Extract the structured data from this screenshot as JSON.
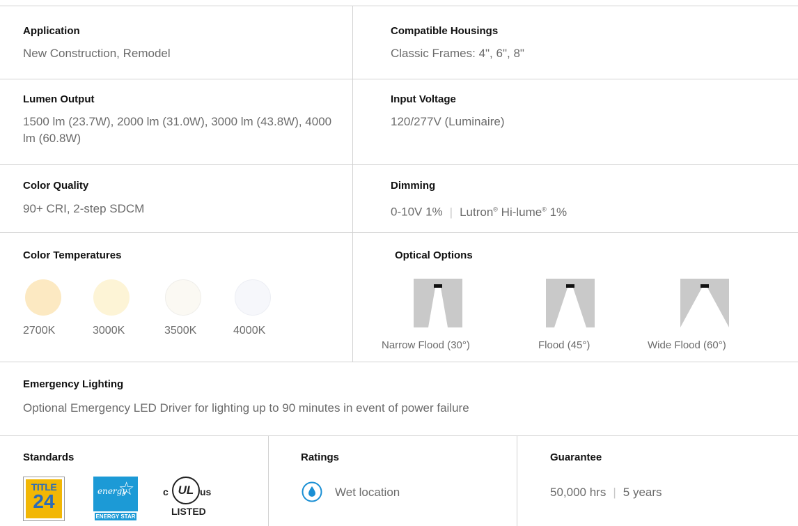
{
  "specs": {
    "application": {
      "label": "Application",
      "value": "New Construction, Remodel"
    },
    "housings": {
      "label": "Compatible Housings",
      "value": "Classic Frames: 4\", 6\", 8\""
    },
    "lumen": {
      "label": "Lumen Output",
      "value": "1500 lm (23.7W), 2000 lm (31.0W), 3000 lm (43.8W), 4000 lm (60.8W)"
    },
    "voltage": {
      "label": "Input Voltage",
      "value": "120/277V (Luminaire)"
    },
    "color_quality": {
      "label": "Color Quality",
      "value": "90+ CRI, 2-step SDCM"
    },
    "dimming": {
      "label": "Dimming",
      "value_a": "0-10V 1%",
      "separator": "|",
      "value_b_prefix": "Lutron",
      "value_b_reg1": "®",
      "value_b_mid": " Hi-lume",
      "value_b_reg2": "®",
      "value_b_suffix": " 1%"
    }
  },
  "color_temps": {
    "label": "Color Temperatures",
    "items": [
      {
        "label": "2700K",
        "color": "#fce9c2"
      },
      {
        "label": "3000K",
        "color": "#fdf4d6"
      },
      {
        "label": "3500K",
        "color": "#fcfaf4"
      },
      {
        "label": "4000K",
        "color": "#f6f7fb"
      }
    ]
  },
  "optics": {
    "label": "Optical Options",
    "items": [
      {
        "label": "Narrow Flood (30°)",
        "angle_deg": 30
      },
      {
        "label": "Flood (45°)",
        "angle_deg": 45
      },
      {
        "label": "Wide Flood (60°)",
        "angle_deg": 60
      }
    ]
  },
  "emergency": {
    "label": "Emergency Lighting",
    "value": "Optional Emergency LED Driver for lighting up to 90 minutes in event of power failure"
  },
  "standards": {
    "label": "Standards",
    "title24": {
      "line1": "TITLE",
      "line2": "24"
    },
    "energy_star": {
      "script": "energy",
      "caption": "ENERGY STAR"
    },
    "ul": {
      "left": "c",
      "mark": "UL",
      "right": "us",
      "caption": "LISTED"
    }
  },
  "ratings": {
    "label": "Ratings",
    "value": "Wet location",
    "icon": "water-drop-icon",
    "accent": "#1a8fd4"
  },
  "guarantee": {
    "label": "Guarantee",
    "hours": "50,000 hrs",
    "separator": "|",
    "years": "5 years"
  }
}
